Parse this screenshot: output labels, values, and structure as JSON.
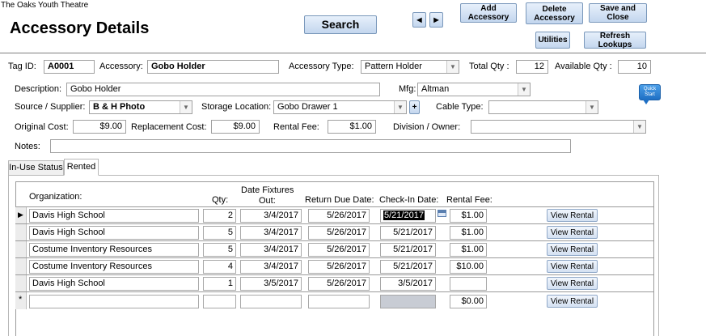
{
  "app": {
    "name": "The Oaks Youth Theatre"
  },
  "page": {
    "title": "Accessory Details"
  },
  "toolbar": {
    "search": "Search",
    "prev_icon": "triangle-left-icon",
    "next_icon": "triangle-right-icon",
    "add_accessory": "Add Accessory",
    "delete_accessory": "Delete Accessory",
    "save_and_close": "Save and Close",
    "utilities": "Utilities",
    "refresh_lookups": "Refresh Lookups"
  },
  "form": {
    "tag_id": {
      "label": "Tag ID:",
      "value": "A0001"
    },
    "accessory": {
      "label": "Accessory:",
      "value": "Gobo Holder"
    },
    "accessory_type": {
      "label": "Accessory Type:",
      "value": "Pattern Holder"
    },
    "total_qty": {
      "label": "Total Qty :",
      "value": "12"
    },
    "available_qty": {
      "label": "Available Qty :",
      "value": "10"
    },
    "description": {
      "label": "Description:",
      "value": "Gobo Holder"
    },
    "mfg": {
      "label": "Mfg:",
      "value": "Altman"
    },
    "quick_start": "Quick Start",
    "source_supplier": {
      "label": "Source / Supplier:",
      "value": "B & H Photo"
    },
    "storage_location": {
      "label": "Storage Location:",
      "value": "Gobo Drawer 1"
    },
    "storage_add": "+",
    "cable_type": {
      "label": "Cable Type:",
      "value": ""
    },
    "original_cost": {
      "label": "Original Cost:",
      "value": "$9.00"
    },
    "replacement_cost": {
      "label": "Replacement Cost:",
      "value": "$9.00"
    },
    "rental_fee": {
      "label": "Rental Fee:",
      "value": "$1.00"
    },
    "division_owner": {
      "label": "Division / Owner:",
      "value": ""
    },
    "notes": {
      "label": "Notes:",
      "value": ""
    }
  },
  "tabs": [
    {
      "label": "In-Use Status",
      "active": false
    },
    {
      "label": "Rented",
      "active": true
    }
  ],
  "rentals": {
    "headers": {
      "organization": "Organization:",
      "qty": "Qty:",
      "date_out_line1": "Date Fixtures",
      "date_out_line2": "Out:",
      "return_due": "Return Due Date:",
      "checkin": "Check-In Date:",
      "rental_fee": "Rental Fee:"
    },
    "rows": [
      {
        "organization": "Davis High School",
        "qty": "2",
        "date_out": "3/4/2017",
        "return_due": "5/26/2017",
        "checkin": "5/21/2017",
        "fee": "$1.00",
        "action": "View Rental",
        "current": true
      },
      {
        "organization": "Davis High School",
        "qty": "5",
        "date_out": "3/4/2017",
        "return_due": "5/26/2017",
        "checkin": "5/21/2017",
        "fee": "$1.00",
        "action": "View Rental"
      },
      {
        "organization": "Costume Inventory Resources",
        "qty": "5",
        "date_out": "3/4/2017",
        "return_due": "5/26/2017",
        "checkin": "5/21/2017",
        "fee": "$1.00",
        "action": "View Rental"
      },
      {
        "organization": "Costume Inventory Resources",
        "qty": "4",
        "date_out": "3/4/2017",
        "return_due": "5/26/2017",
        "checkin": "5/21/2017",
        "fee": "$10.00",
        "action": "View Rental"
      },
      {
        "organization": "Davis High School",
        "qty": "1",
        "date_out": "3/5/2017",
        "return_due": "5/26/2017",
        "checkin": "3/5/2017",
        "fee": "",
        "action": "View Rental"
      }
    ],
    "new_row": {
      "marker": "*",
      "fee": "$0.00",
      "action": "View Rental"
    },
    "current_marker": "▶"
  }
}
